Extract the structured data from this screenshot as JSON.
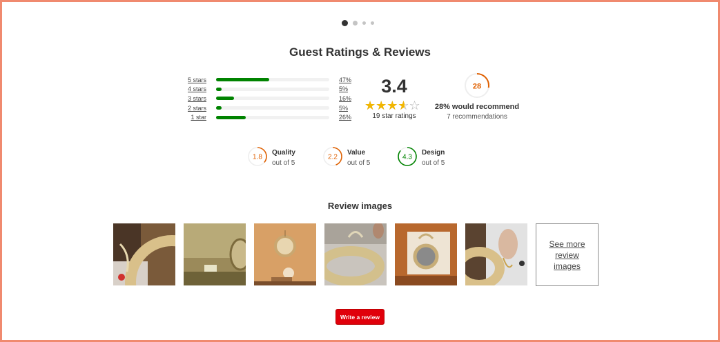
{
  "carousel": {
    "dots": 4,
    "active_index": 0
  },
  "title": "Guest Ratings & Reviews",
  "distribution": [
    {
      "label": "5 stars",
      "pct": "47%",
      "value": 47
    },
    {
      "label": "4 stars",
      "pct": "5%",
      "value": 5
    },
    {
      "label": "3 stars",
      "pct": "16%",
      "value": 16
    },
    {
      "label": "2 stars",
      "pct": "5%",
      "value": 5
    },
    {
      "label": "1 star",
      "pct": "26%",
      "value": 26
    }
  ],
  "average": {
    "value": "3.4",
    "rating": 3.4,
    "max": 5,
    "count_label": "19 star ratings"
  },
  "recommend": {
    "ring_value": "28",
    "percent": 28,
    "title": "28% would recommend",
    "subtitle": "7 recommendations"
  },
  "attributes": [
    {
      "name": "Quality",
      "value": "1.8",
      "score": 1.8,
      "sub": "out of 5",
      "color": "#e06000"
    },
    {
      "name": "Value",
      "value": "2.2",
      "score": 2.2,
      "sub": "out of 5",
      "color": "#e06000"
    },
    {
      "name": "Design",
      "value": "4.3",
      "score": 4.3,
      "sub": "out of 5",
      "color": "#008300"
    }
  ],
  "review_images": {
    "title": "Review images",
    "see_more": "See more review images",
    "thumbnails": [
      "review-image-1",
      "review-image-2",
      "review-image-3",
      "review-image-4",
      "review-image-5",
      "review-image-6"
    ]
  },
  "write_review": {
    "label": "Write a review"
  },
  "colors": {
    "accent_red": "#e0000b",
    "bar_green": "#008300",
    "ring_orange": "#e06000",
    "star_gold": "#f2b600",
    "frame": "#f08a6f"
  }
}
